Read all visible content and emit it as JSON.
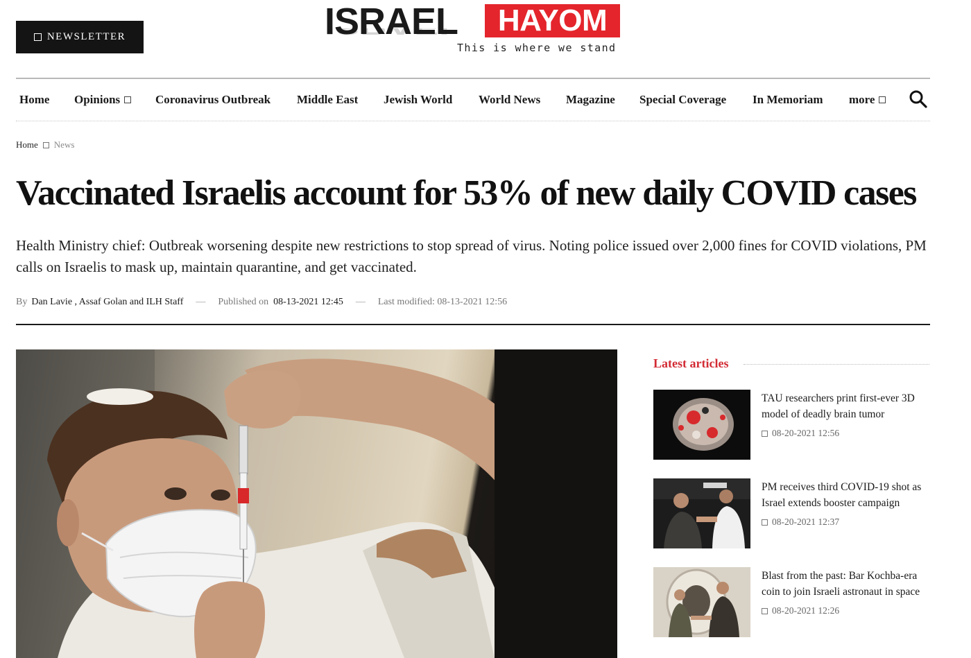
{
  "header": {
    "newsletter_label": "NEWSLETTER",
    "logo": {
      "word_left": "ISRAEL",
      "word_right": "HAYOM",
      "tagline": "This is where we stand",
      "brand_red": "#e4252c"
    }
  },
  "nav": {
    "items": [
      {
        "label": "Home",
        "has_dropdown": false
      },
      {
        "label": "Opinions",
        "has_dropdown": true
      },
      {
        "label": "Coronavirus Outbreak",
        "has_dropdown": false
      },
      {
        "label": "Middle East",
        "has_dropdown": false
      },
      {
        "label": "Jewish World",
        "has_dropdown": false
      },
      {
        "label": "World News",
        "has_dropdown": false
      },
      {
        "label": "Magazine",
        "has_dropdown": false
      },
      {
        "label": "Special Coverage",
        "has_dropdown": false
      },
      {
        "label": "In Memoriam",
        "has_dropdown": false
      },
      {
        "label": "more",
        "has_dropdown": true
      }
    ],
    "search_icon": "search-icon"
  },
  "breadcrumb": {
    "home": "Home",
    "current": "News"
  },
  "article": {
    "headline": "Vaccinated Israelis account for 53% of new daily COVID cases",
    "subhead": "Health Ministry chief: Outbreak worsening despite new restrictions to stop spread of virus. Noting police issued over 2,000 fines for COVID violations, PM calls on Israelis to mask up, maintain quarantine, and get vaccinated.",
    "meta": {
      "by_label": "By",
      "authors": "Dan Lavie , Assaf Golan and ILH Staff",
      "published_label": "Published on",
      "published_date": "08-13-2021 12:45",
      "modified": "Last modified: 08-13-2021 12:56"
    }
  },
  "sidebar": {
    "title": "Latest articles",
    "accent": "#d22b34",
    "articles": [
      {
        "title": "TAU researchers print first-ever 3D model of deadly brain tumor",
        "date": "08-20-2021 12:56"
      },
      {
        "title": "PM receives third COVID-19 shot as Israel extends booster campaign",
        "date": "08-20-2021 12:37"
      },
      {
        "title": "Blast from the past: Bar Kochba-era coin to join Israeli astronaut in space",
        "date": "08-20-2021 12:26"
      }
    ]
  }
}
